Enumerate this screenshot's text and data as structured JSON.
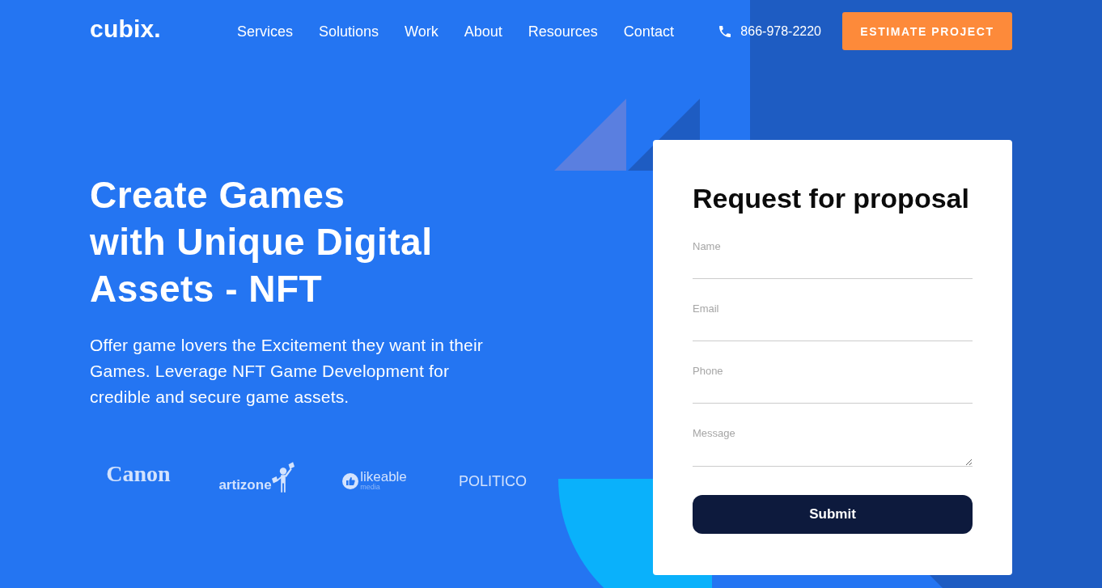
{
  "header": {
    "logo": "cubix.",
    "nav": [
      "Services",
      "Solutions",
      "Work",
      "About",
      "Resources",
      "Contact"
    ],
    "phone": "866-978-2220",
    "cta": "ESTIMATE PROJECT"
  },
  "hero": {
    "headline": [
      "Create Games",
      "with Unique Digital",
      "Assets - NFT"
    ],
    "description": [
      "Offer game lovers the Excitement they want in their",
      "Games. Leverage NFT Game Development for",
      "credible and secure game assets."
    ],
    "clients": [
      {
        "kind": "serif",
        "name": "Canon"
      },
      {
        "kind": "figure",
        "name": "artizone"
      },
      {
        "kind": "thumb",
        "name": "likeable",
        "caption": "media"
      },
      {
        "kind": "sans",
        "name": "POLITICO"
      }
    ]
  },
  "form": {
    "title": "Request for proposal",
    "fields": [
      {
        "kind": "input",
        "placeholder": "Name"
      },
      {
        "kind": "input",
        "placeholder": "Email"
      },
      {
        "kind": "input",
        "placeholder": "Phone"
      },
      {
        "kind": "textarea",
        "placeholder": "Message"
      }
    ],
    "submit": "Submit"
  }
}
